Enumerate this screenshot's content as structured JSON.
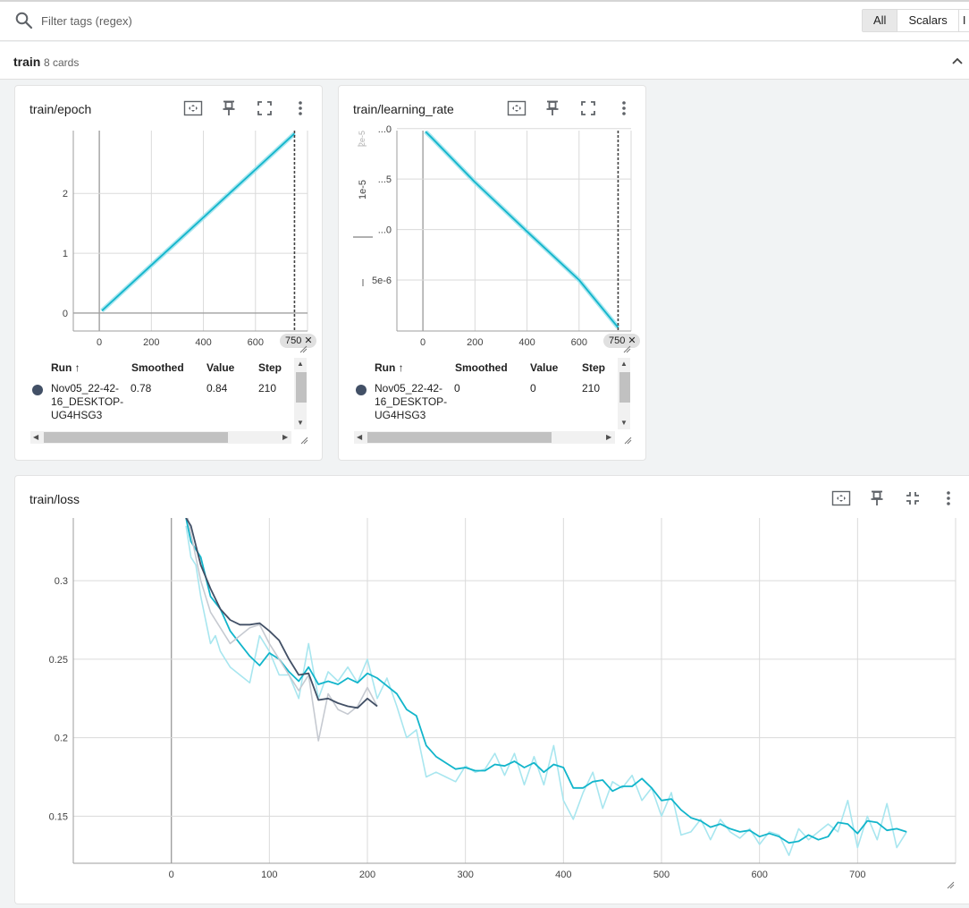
{
  "filter": {
    "placeholder": "Filter tags (regex)"
  },
  "type_toggle": [
    {
      "label": "All",
      "active": true
    },
    {
      "label": "Scalars",
      "active": false
    },
    {
      "label": "I",
      "active": false
    }
  ],
  "group": {
    "title": "train",
    "count": "8 cards"
  },
  "colors": {
    "accent": "#12b5cb",
    "accent_light": "#a8e6ef",
    "dark_run": "#425066",
    "dark_run_light": "#c6cad1",
    "grid": "#dadada",
    "axis": "#a0a0a0"
  },
  "icons": [
    "search-icon",
    "chevron-up-icon",
    "fit-domain-icon",
    "pin-icon",
    "fullscreen-icon",
    "exit-fullscreen-icon",
    "more-vert-icon",
    "sort-arrow-up-icon"
  ],
  "cards": {
    "epoch": {
      "title": "train/epoch",
      "step_pill": "750",
      "table": {
        "headers": [
          "Run",
          "Smoothed",
          "Value",
          "Step"
        ],
        "rows": [
          {
            "run": "Nov05_22-42-16_DESKTOP-UG4HSG3",
            "run_lines": [
              "Nov05_22-42-",
              "16_DESKTOP-",
              "UG4HSG3"
            ],
            "smoothed": "0.78",
            "value": "0.84",
            "step": "210"
          }
        ]
      }
    },
    "lr": {
      "title": "train/learning_rate",
      "step_pill": "750",
      "axis_fragment_labels": [
        "1e-5",
        "2e-5"
      ],
      "table": {
        "headers": [
          "Run",
          "Smoothed",
          "Value",
          "Step"
        ],
        "rows": [
          {
            "run": "Nov05_22-42-16_DESKTOP-UG4HSG3",
            "run_lines": [
              "Nov05_22-42-",
              "16_DESKTOP-",
              "UG4HSG3"
            ],
            "smoothed": "0",
            "value": "0",
            "step": "210"
          }
        ]
      }
    },
    "loss": {
      "title": "train/loss"
    }
  },
  "chart_data": [
    {
      "type": "line",
      "title": "train/epoch",
      "xlim": [
        -100,
        800
      ],
      "ylim": [
        -0.3,
        3.05
      ],
      "x_ticks": [
        0,
        200,
        400,
        600
      ],
      "x_tick_labels": [
        "0",
        "200",
        "400",
        "600"
      ],
      "y_ticks": [
        0,
        1,
        2
      ],
      "y_tick_labels": [
        "0",
        "1",
        "2"
      ],
      "hover_step": 750,
      "series": [
        {
          "x": [
            10,
            100,
            250,
            400,
            500,
            600,
            750
          ],
          "y": [
            0.04,
            0.4,
            1.0,
            1.6,
            2.0,
            2.4,
            3.0
          ]
        }
      ]
    },
    {
      "type": "line",
      "title": "train/learning_rate",
      "xlim": [
        -100,
        800
      ],
      "ylim": [
        -5e-08,
        1.98e-05
      ],
      "x_ticks": [
        0,
        200,
        400,
        600
      ],
      "x_tick_labels": [
        "0",
        "200",
        "400",
        "600"
      ],
      "y_ticks": [
        5e-06,
        1e-05,
        1.5e-05,
        2e-05
      ],
      "y_tick_labels": [
        "5e-6",
        "...0",
        "...5",
        "...0"
      ],
      "hover_step": 750,
      "series": [
        {
          "x": [
            10,
            30,
            200,
            400,
            600,
            750
          ],
          "y": [
            1.97e-05,
            1.92e-05,
            1.47e-05,
            9.8e-06,
            5e-06,
            3e-07
          ]
        }
      ]
    },
    {
      "type": "line",
      "title": "train/loss",
      "xlim": [
        -100,
        800
      ],
      "ylim": [
        0.12,
        0.34
      ],
      "x_ticks": [
        0,
        100,
        200,
        300,
        400,
        500,
        600,
        700
      ],
      "x_tick_labels": [
        "0",
        "100",
        "200",
        "300",
        "400",
        "500",
        "600",
        "700"
      ],
      "y_ticks": [
        0.15,
        0.2,
        0.25,
        0.3
      ],
      "y_tick_labels": [
        "0.15",
        "0.2",
        "0.25",
        "0.3"
      ],
      "series": [
        {
          "role": "raw",
          "color": "#a8e6ef",
          "x": [
            15,
            20,
            25,
            30,
            35,
            40,
            45,
            50,
            60,
            70,
            80,
            90,
            100,
            110,
            120,
            130,
            140,
            150,
            160,
            170,
            180,
            190,
            200,
            210,
            220,
            230,
            240,
            250,
            260,
            270,
            280,
            290,
            300,
            310,
            320,
            330,
            340,
            350,
            360,
            370,
            380,
            390,
            400,
            410,
            420,
            430,
            440,
            450,
            460,
            470,
            480,
            490,
            500,
            510,
            520,
            530,
            540,
            550,
            560,
            570,
            580,
            590,
            600,
            610,
            620,
            630,
            640,
            650,
            660,
            670,
            680,
            690,
            700,
            710,
            720,
            730,
            740,
            750
          ],
          "y": [
            0.335,
            0.315,
            0.31,
            0.29,
            0.275,
            0.26,
            0.265,
            0.255,
            0.245,
            0.24,
            0.235,
            0.265,
            0.255,
            0.24,
            0.24,
            0.225,
            0.26,
            0.225,
            0.242,
            0.236,
            0.245,
            0.235,
            0.25,
            0.225,
            0.238,
            0.22,
            0.2,
            0.205,
            0.175,
            0.178,
            0.175,
            0.172,
            0.182,
            0.178,
            0.18,
            0.19,
            0.176,
            0.19,
            0.17,
            0.188,
            0.17,
            0.195,
            0.16,
            0.148,
            0.165,
            0.178,
            0.155,
            0.172,
            0.168,
            0.176,
            0.16,
            0.168,
            0.15,
            0.165,
            0.138,
            0.14,
            0.148,
            0.135,
            0.148,
            0.14,
            0.136,
            0.142,
            0.132,
            0.14,
            0.138,
            0.125,
            0.142,
            0.135,
            0.14,
            0.145,
            0.14,
            0.16,
            0.13,
            0.15,
            0.135,
            0.158,
            0.13,
            0.14
          ]
        },
        {
          "role": "smoothed",
          "color": "#12b5cb",
          "x": [
            15,
            20,
            30,
            40,
            50,
            60,
            70,
            80,
            90,
            100,
            110,
            120,
            130,
            140,
            150,
            160,
            170,
            180,
            190,
            200,
            210,
            220,
            230,
            240,
            250,
            260,
            270,
            280,
            290,
            300,
            310,
            320,
            330,
            340,
            350,
            360,
            370,
            380,
            390,
            400,
            410,
            420,
            430,
            440,
            450,
            460,
            470,
            480,
            490,
            500,
            510,
            520,
            530,
            540,
            550,
            560,
            570,
            580,
            590,
            600,
            610,
            620,
            630,
            640,
            650,
            660,
            670,
            680,
            690,
            700,
            710,
            720,
            730,
            740,
            750
          ],
          "y": [
            0.34,
            0.325,
            0.315,
            0.29,
            0.282,
            0.268,
            0.26,
            0.252,
            0.246,
            0.254,
            0.25,
            0.242,
            0.236,
            0.245,
            0.234,
            0.236,
            0.234,
            0.238,
            0.235,
            0.241,
            0.238,
            0.233,
            0.228,
            0.218,
            0.214,
            0.195,
            0.188,
            0.184,
            0.18,
            0.181,
            0.179,
            0.179,
            0.183,
            0.182,
            0.185,
            0.181,
            0.184,
            0.178,
            0.183,
            0.181,
            0.168,
            0.168,
            0.172,
            0.173,
            0.166,
            0.169,
            0.169,
            0.174,
            0.168,
            0.16,
            0.161,
            0.154,
            0.149,
            0.147,
            0.143,
            0.145,
            0.142,
            0.14,
            0.141,
            0.137,
            0.139,
            0.137,
            0.133,
            0.134,
            0.138,
            0.135,
            0.137,
            0.146,
            0.145,
            0.139,
            0.147,
            0.146,
            0.141,
            0.142,
            0.14
          ]
        },
        {
          "role": "raw",
          "color": "#c6cad1",
          "x": [
            15,
            20,
            30,
            40,
            50,
            60,
            70,
            80,
            90,
            100,
            110,
            120,
            130,
            140,
            150,
            160,
            170,
            180,
            190,
            200,
            210
          ],
          "y": [
            0.345,
            0.33,
            0.3,
            0.28,
            0.27,
            0.26,
            0.265,
            0.27,
            0.272,
            0.26,
            0.25,
            0.24,
            0.23,
            0.24,
            0.198,
            0.228,
            0.218,
            0.215,
            0.22,
            0.232,
            0.22
          ]
        },
        {
          "role": "smoothed",
          "color": "#425066",
          "x": [
            15,
            20,
            30,
            40,
            50,
            60,
            70,
            80,
            90,
            100,
            110,
            120,
            130,
            140,
            150,
            160,
            170,
            180,
            190,
            200,
            210
          ],
          "y": [
            0.34,
            0.335,
            0.31,
            0.295,
            0.282,
            0.275,
            0.272,
            0.272,
            0.273,
            0.268,
            0.262,
            0.25,
            0.24,
            0.241,
            0.224,
            0.225,
            0.222,
            0.22,
            0.219,
            0.225,
            0.22
          ]
        }
      ]
    }
  ]
}
